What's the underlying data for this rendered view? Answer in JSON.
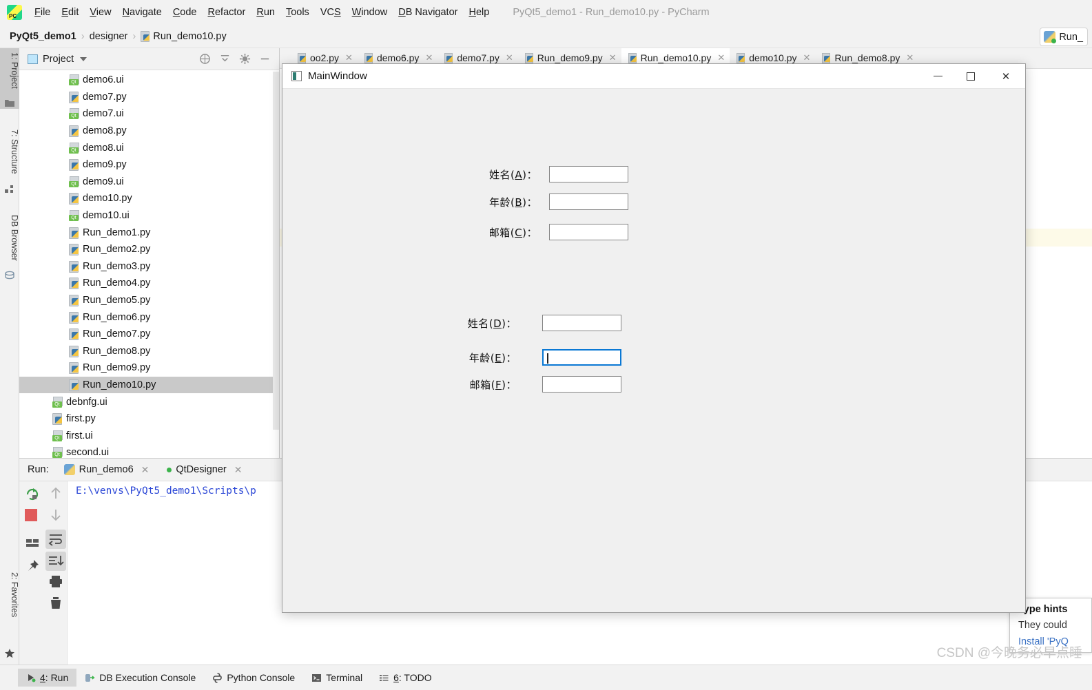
{
  "app": {
    "window_title": "PyQt5_demo1 - Run_demo10.py - PyCharm",
    "logo_icon": "pycharm-logo-icon"
  },
  "menubar": {
    "items": [
      {
        "label": "File",
        "mnemonic": "F"
      },
      {
        "label": "Edit",
        "mnemonic": "E"
      },
      {
        "label": "View",
        "mnemonic": "V"
      },
      {
        "label": "Navigate",
        "mnemonic": "N"
      },
      {
        "label": "Code",
        "mnemonic": "C"
      },
      {
        "label": "Refactor",
        "mnemonic": "R"
      },
      {
        "label": "Run",
        "mnemonic": "R"
      },
      {
        "label": "Tools",
        "mnemonic": "T"
      },
      {
        "label": "VCS",
        "mnemonic": "S"
      },
      {
        "label": "Window",
        "mnemonic": "W"
      },
      {
        "label": "DB Navigator",
        "mnemonic": "D"
      },
      {
        "label": "Help",
        "mnemonic": "H"
      }
    ]
  },
  "breadcrumb": {
    "items": [
      "PyQt5_demo1",
      "designer",
      "Run_demo10.py"
    ],
    "separator": "›",
    "file_icon": "python-file-icon"
  },
  "toolbar": {
    "run_button_label": "Run_",
    "run_button_icon": "python-run-icon"
  },
  "left_toolstrip": {
    "tabs": [
      {
        "label": "1: Project",
        "mnemonic": "1",
        "active": true,
        "icon": "folder-icon"
      },
      {
        "label": "7: Structure",
        "mnemonic": "7",
        "active": false,
        "icon": "structure-icon"
      },
      {
        "label": "DB Browser",
        "mnemonic": "",
        "active": false,
        "icon": "database-icon"
      },
      {
        "label": "2: Favorites",
        "mnemonic": "2",
        "active": false,
        "icon": "star-icon"
      }
    ]
  },
  "project_panel": {
    "title": "Project",
    "dropdown_icon": "chevron-down-icon",
    "toolbar_icons": [
      "target-icon",
      "collapse-all-icon",
      "settings-gear-icon",
      "hide-icon"
    ],
    "files": [
      {
        "name": "demo6.ui",
        "type": "qt",
        "indent": 2,
        "selected": false
      },
      {
        "name": "demo7.py",
        "type": "python",
        "indent": 2,
        "selected": false
      },
      {
        "name": "demo7.ui",
        "type": "qt",
        "indent": 2,
        "selected": false
      },
      {
        "name": "demo8.py",
        "type": "python",
        "indent": 2,
        "selected": false
      },
      {
        "name": "demo8.ui",
        "type": "qt",
        "indent": 2,
        "selected": false
      },
      {
        "name": "demo9.py",
        "type": "python",
        "indent": 2,
        "selected": false
      },
      {
        "name": "demo9.ui",
        "type": "qt",
        "indent": 2,
        "selected": false
      },
      {
        "name": "demo10.py",
        "type": "python",
        "indent": 2,
        "selected": false
      },
      {
        "name": "demo10.ui",
        "type": "qt",
        "indent": 2,
        "selected": false
      },
      {
        "name": "Run_demo1.py",
        "type": "python",
        "indent": 2,
        "selected": false
      },
      {
        "name": "Run_demo2.py",
        "type": "python",
        "indent": 2,
        "selected": false
      },
      {
        "name": "Run_demo3.py",
        "type": "python",
        "indent": 2,
        "selected": false
      },
      {
        "name": "Run_demo4.py",
        "type": "python",
        "indent": 2,
        "selected": false
      },
      {
        "name": "Run_demo5.py",
        "type": "python",
        "indent": 2,
        "selected": false
      },
      {
        "name": "Run_demo6.py",
        "type": "python",
        "indent": 2,
        "selected": false
      },
      {
        "name": "Run_demo7.py",
        "type": "python",
        "indent": 2,
        "selected": false
      },
      {
        "name": "Run_demo8.py",
        "type": "python",
        "indent": 2,
        "selected": false
      },
      {
        "name": "Run_demo9.py",
        "type": "python",
        "indent": 2,
        "selected": false
      },
      {
        "name": "Run_demo10.py",
        "type": "python",
        "indent": 2,
        "selected": true
      },
      {
        "name": "debnfg.ui",
        "type": "qt",
        "indent": 1,
        "selected": false
      },
      {
        "name": "first.py",
        "type": "python",
        "indent": 1,
        "selected": false
      },
      {
        "name": "first.ui",
        "type": "qt",
        "indent": 1,
        "selected": false
      },
      {
        "name": "second.ui",
        "type": "qt",
        "indent": 1,
        "selected": false
      }
    ]
  },
  "editor_tabs": [
    {
      "label": "oo2.py",
      "active": false
    },
    {
      "label": "demo6.py",
      "active": false
    },
    {
      "label": "demo7.py",
      "active": false
    },
    {
      "label": "Run_demo9.py",
      "active": false
    },
    {
      "label": "Run_demo10.py",
      "active": true
    },
    {
      "label": "demo10.py",
      "active": false
    },
    {
      "label": "Run_demo8.py",
      "active": false
    }
  ],
  "run_panel": {
    "label": "Run:",
    "tabs": [
      {
        "label": "Run_demo6",
        "icon": "python-run-icon",
        "closable": true
      },
      {
        "label": "QtDesigner",
        "icon": "green-dot-icon",
        "closable": true
      }
    ],
    "console_text": "E:\\venvs\\PyQt5_demo1\\Scripts\\p",
    "side_icons": [
      "rerun-icon",
      "stop-icon",
      "layout-icon",
      "pin-icon",
      "arrow-up-icon",
      "arrow-down-icon",
      "soft-wrap-icon",
      "scroll-to-end-icon",
      "print-icon",
      "trash-icon"
    ]
  },
  "status_bar": {
    "items": [
      {
        "label": "4: Run",
        "mnemonic": "4",
        "icon": "run-arrow-icon",
        "active": true
      },
      {
        "label": "DB Execution Console",
        "mnemonic": "",
        "icon": "database-console-icon",
        "active": false
      },
      {
        "label": "Python Console",
        "mnemonic": "",
        "icon": "python-console-icon",
        "active": false
      },
      {
        "label": "Terminal",
        "mnemonic": "",
        "icon": "terminal-icon",
        "active": false
      },
      {
        "label": "6: TODO",
        "mnemonic": "6",
        "icon": "todo-list-icon",
        "active": false
      }
    ]
  },
  "type_hints_popup": {
    "title": "Type hints",
    "body": "They could",
    "link": "Install 'PyQ",
    "grip_icon": "resize-grip-icon"
  },
  "watermark": "CSDN @今晚务必早点睡",
  "dialog": {
    "title": "MainWindow",
    "app_icon": "mainwindow-app-icon",
    "window_buttons": {
      "minimize": "minimize-icon",
      "maximize": "maximize-icon",
      "close": "close-icon"
    },
    "group_top": [
      {
        "label_prefix": "姓名(",
        "mnemonic": "A",
        "label_suffix": ")：",
        "value": "",
        "focused": false
      },
      {
        "label_prefix": "年龄(",
        "mnemonic": "B",
        "label_suffix": ")：",
        "value": "",
        "focused": false
      },
      {
        "label_prefix": "邮箱(",
        "mnemonic": "C",
        "label_suffix": ")：",
        "value": "",
        "focused": false
      }
    ],
    "group_bottom": [
      {
        "label_prefix": "姓名(",
        "mnemonic": "D",
        "label_suffix": ")：",
        "value": "",
        "focused": false
      },
      {
        "label_prefix": "年龄(",
        "mnemonic": "E",
        "label_suffix": ")：",
        "value": "",
        "focused": true
      },
      {
        "label_prefix": "邮箱(",
        "mnemonic": "F",
        "label_suffix": ")：",
        "value": "",
        "focused": false
      }
    ]
  },
  "colors": {
    "accent_blue": "#0a78d4",
    "panel_bg": "#f2f2f2",
    "dialog_bg": "#f0f0f0",
    "selection_gray": "#c9c9c9",
    "code_highlight": "#fdfae8",
    "link_blue": "#3b72c4",
    "console_text": "#2a46d6"
  }
}
